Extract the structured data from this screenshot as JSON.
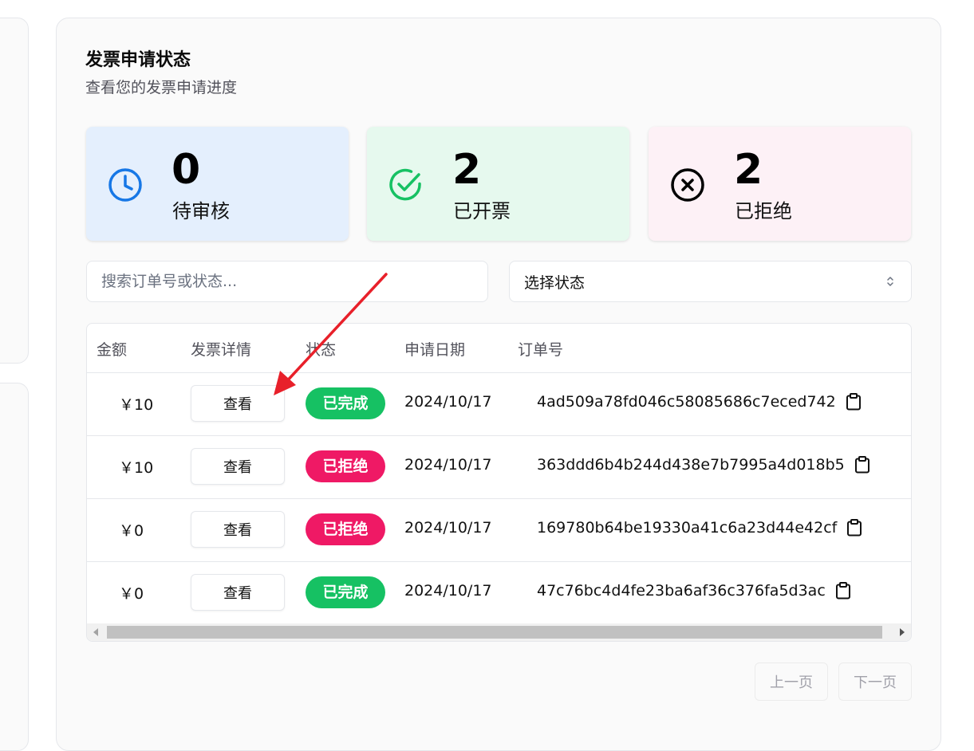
{
  "panel": {
    "title": "发票申请状态",
    "subtitle": "查看您的发票申请进度"
  },
  "stats": {
    "pending": {
      "value": "0",
      "label": "待审核",
      "icon": "clock-icon",
      "color": "#1677e6"
    },
    "issued": {
      "value": "2",
      "label": "已开票",
      "icon": "check-circle-icon",
      "color": "#16c163"
    },
    "rejected": {
      "value": "2",
      "label": "已拒绝",
      "icon": "x-circle-icon",
      "color": "#000000"
    }
  },
  "search": {
    "placeholder": "搜索订单号或状态..."
  },
  "status_select": {
    "value": "选择状态"
  },
  "table": {
    "headers": {
      "amount": "金额",
      "details": "发票详情",
      "status": "状态",
      "date": "申请日期",
      "order": "订单号"
    },
    "rows": [
      {
        "amount": "￥10",
        "view": "查看",
        "status": "已完成",
        "date": "2024/10/17",
        "order": "4ad509a78fd046c58085686c7eced742"
      },
      {
        "amount": "￥10",
        "view": "查看",
        "status": "已拒绝",
        "date": "2024/10/17",
        "order": "363ddd6b4b244d438e7b7995a4d018b5"
      },
      {
        "amount": "￥0",
        "view": "查看",
        "status": "已拒绝",
        "date": "2024/10/17",
        "order": "169780b64be19330a41c6a23d44e42cf"
      },
      {
        "amount": "￥0",
        "view": "查看",
        "status": "已完成",
        "date": "2024/10/17",
        "order": "47c76bc4d4fe23ba6af36c376fa5d3ac"
      }
    ]
  },
  "pagination": {
    "prev": "上一页",
    "next": "下一页"
  },
  "colors": {
    "completed": "#16c163",
    "rejected": "#ef1965",
    "annotation_arrow": "#e8202a"
  }
}
